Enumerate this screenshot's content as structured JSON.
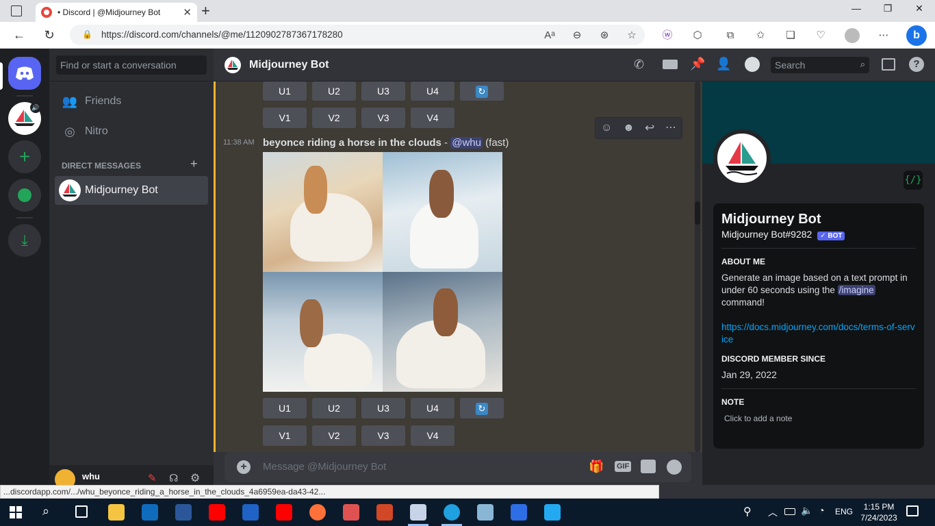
{
  "browser": {
    "tab_title": "• Discord | @Midjourney Bot",
    "url": "https://discord.com/channels/@me/1120902787367178280",
    "status_url": "...discordapp.com/.../whu_beyonce_riding_a_horse_in_the_clouds_4a6959ea-da43-42..."
  },
  "sidebar": {
    "search_placeholder": "Find or start a conversation",
    "friends_label": "Friends",
    "nitro_label": "Nitro",
    "dm_header": "DIRECT MESSAGES",
    "dm_items": [
      {
        "label": "Midjourney Bot"
      }
    ],
    "user": {
      "name": "whu"
    }
  },
  "header": {
    "channel_title": "Midjourney Bot",
    "search_placeholder": "Search"
  },
  "messages": {
    "top_row_u": [
      "U1",
      "U2",
      "U3",
      "U4"
    ],
    "top_row_v": [
      "V1",
      "V2",
      "V3",
      "V4"
    ],
    "time": "11:38 AM",
    "prompt": "beyonce riding a horse in the clouds",
    "separator": " - ",
    "mention": "@whu",
    "mode": "(fast)",
    "bottom_row_u": [
      "U1",
      "U2",
      "U3",
      "U4"
    ],
    "bottom_row_v": [
      "V1",
      "V2",
      "V3",
      "V4"
    ]
  },
  "composer": {
    "placeholder": "Message @Midjourney Bot",
    "gif_label": "GIF"
  },
  "profile": {
    "name": "Midjourney Bot",
    "tag": "Midjourney Bot#9282",
    "bot_badge": "✓ BOT",
    "about_header": "ABOUT ME",
    "about_text_1": "Generate an image based on a text prompt in under 60 seconds using the",
    "about_cmd": "/imagine",
    "about_text_2": "command!",
    "link": "https://docs.midjourney.com/docs/terms-of-service",
    "member_header": "DISCORD MEMBER SINCE",
    "member_since": "Jan 29, 2022",
    "note_header": "NOTE",
    "note_placeholder": "Click to add a note"
  },
  "taskbar": {
    "lang": "ENG",
    "time": "1:15 PM",
    "date": "7/24/2023"
  },
  "colors": {
    "blurple": "#5865f2",
    "mention_bg": "#3c4270",
    "link": "#00a8fc",
    "highlight_bar": "#f0b232",
    "green": "#23a559"
  }
}
